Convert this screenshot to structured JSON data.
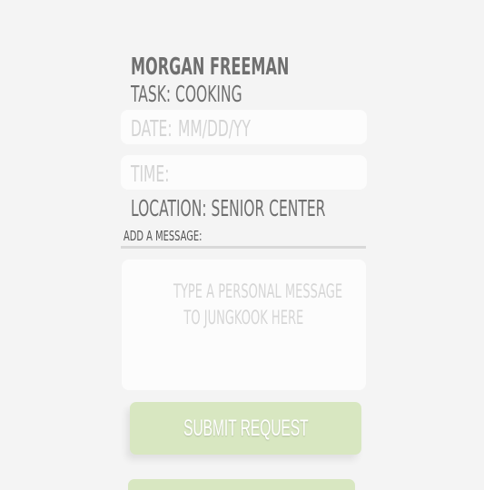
{
  "volunteer": {
    "name": "MORGAN FREEMAN",
    "task": "TASK: COOKING",
    "location": "LOCATION: SENIOR CENTER"
  },
  "date_field": {
    "label": "DATE:",
    "placeholder": "MM/DD/YY"
  },
  "time_field": {
    "label": "TIME:"
  },
  "message": {
    "label": "ADD A MESSAGE:",
    "placeholder_line1": "TYPE A PERSONAL MESSAGE",
    "placeholder_line2": "TO JUNGKOOK HERE"
  },
  "actions": {
    "submit_label": "SUBMIT REQUEST"
  },
  "colors": {
    "background": "#f4f4f4",
    "field_bg": "#fcfcfc",
    "text_dark": "#6f6f6f",
    "text_muted": "#d4d4d4",
    "button_green": "#d8e7c1"
  }
}
